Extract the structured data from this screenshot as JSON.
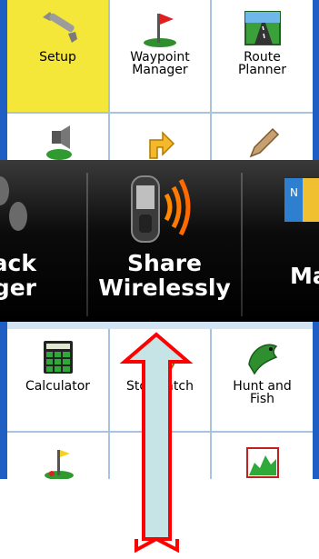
{
  "menu": {
    "top_row": [
      {
        "label": "Setup",
        "icon": "wrench-icon",
        "selected": true
      },
      {
        "label": "Waypoint\nManager",
        "icon": "flag-icon"
      },
      {
        "label": "Route\nPlanner",
        "icon": "road-icon"
      }
    ],
    "bottom_row": [
      {
        "label": "Calculator",
        "icon": "calculator-icon"
      },
      {
        "label": "Stopwatch",
        "icon": "stopwatch-icon"
      },
      {
        "label": "Hunt and\nFish",
        "icon": "fish-icon"
      }
    ]
  },
  "carousel": {
    "items": [
      {
        "label": "ack\nager",
        "icon": "footprints-icon"
      },
      {
        "label": "Share\nWirelessly",
        "icon": "wireless-share-icon"
      },
      {
        "label": "Ma",
        "icon": "map-icon"
      }
    ]
  },
  "colors": {
    "frame": "#1f5ec2",
    "selected": "#f5e63a",
    "arrow_fill": "#c6e4e6",
    "arrow_stroke": "#ff0000"
  }
}
